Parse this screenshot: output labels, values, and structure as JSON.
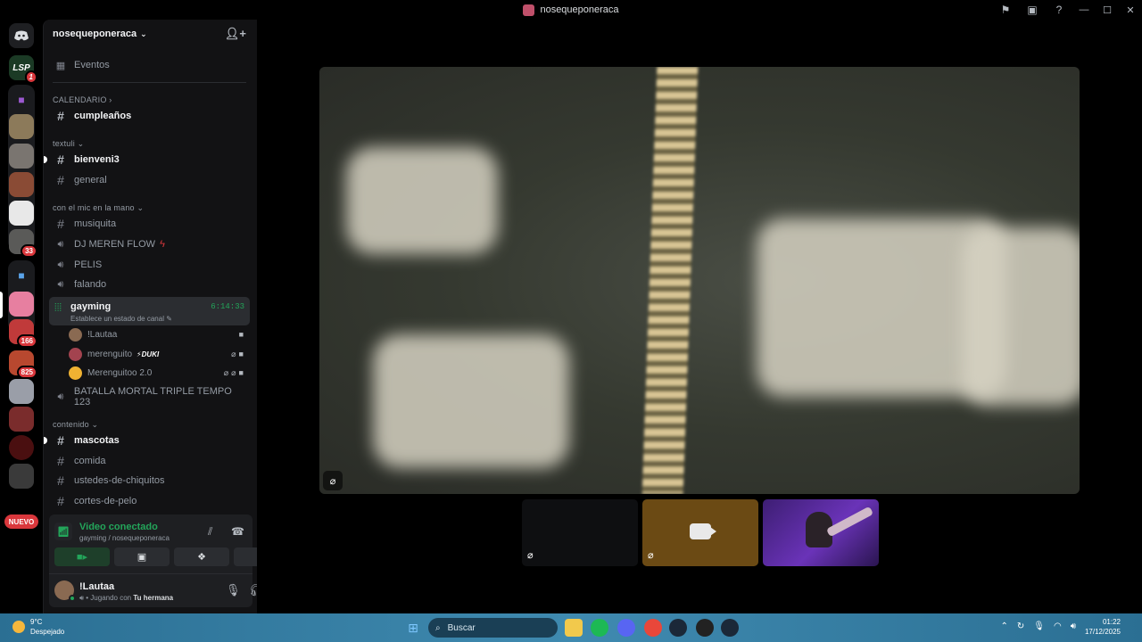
{
  "window": {
    "title": "nosequeponeraca"
  },
  "rail": {
    "badges": {
      "lsp": "1",
      "b1": "33",
      "b2": "166",
      "b3": "825"
    },
    "nuevo_label": "NUEVO"
  },
  "server": {
    "name": "nosequeponeraca"
  },
  "events_label": "Eventos",
  "categories": {
    "calendario": "CALENDARIO",
    "textuli": "textuli",
    "mic": "con el mic en la mano",
    "contenido": "contenido"
  },
  "channels": {
    "cumpleanos": "cumpleaños",
    "bienveni3": "bienveni3",
    "general": "general",
    "musiquita": "musiquita",
    "djmeren": "DJ MEREN FLOW",
    "pelis": "PELIS",
    "falando": "falando",
    "gayming": "gayming",
    "batalla": "BATALLA MORTAL TRIPLE TEMPO 123",
    "mascotas": "mascotas",
    "comida": "comida",
    "chiquitos": "ustedes-de-chiquitos",
    "cortes": "cortes-de-pelo"
  },
  "active_voice": {
    "name": "gayming",
    "status": "Establece un estado de canal",
    "timer": "6:14:33",
    "members": [
      {
        "name": "!Lautaa",
        "color": "#8a6a52"
      },
      {
        "name": "merenguito",
        "tag": "DUKI",
        "color": "#a3434f"
      },
      {
        "name": "Merenguitoo 2.0",
        "color": "#f0b232"
      }
    ]
  },
  "voice_panel": {
    "title": "Video conectado",
    "subtitle": "gayming / nosequeponeraca"
  },
  "user": {
    "name": "!Lautaa",
    "status_prefix": "Jugando con",
    "status_game": "Tu hermana"
  },
  "taskbar": {
    "temp": "9°C",
    "weather": "Despejado",
    "search_placeholder": "Buscar",
    "time": "01:22",
    "date": "17/12/2025"
  },
  "colors": {
    "green": "#23a55a",
    "red": "#da373c",
    "blurple": "#5865f2"
  }
}
